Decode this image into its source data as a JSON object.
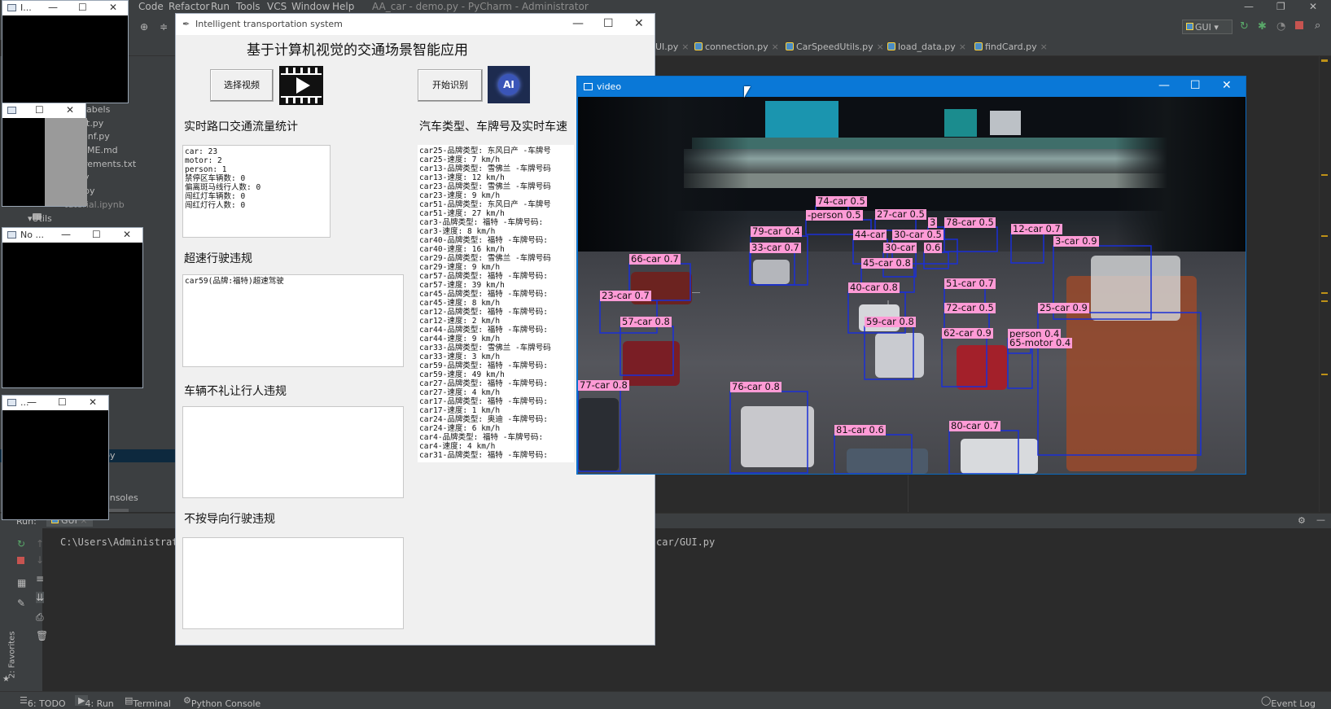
{
  "ide": {
    "menu": [
      "Code",
      "Refactor",
      "Run",
      "Tools",
      "VCS",
      "Window",
      "Help"
    ],
    "title": "AA_car - demo.py - PyCharm - Administrator",
    "run_config": "GUI",
    "tabs": [
      "UI.py",
      "connection.py",
      "CarSpeedUtils.py",
      "load_data.py",
      "findCard.py"
    ],
    "project_items": [
      "labels",
      "t.py",
      "onf.py",
      "ME.md",
      "rements.txt",
      "y",
      "py",
      "tutorial.ipynb",
      "Utils",
      "py",
      "onsoles"
    ],
    "run_label": "Run:",
    "run_tab": "GUI",
    "console_path_left": "C:\\Users\\Administrato",
    "console_path_right": "car/GUI.py",
    "status_items": [
      "6: TODO",
      "4: Run",
      "Terminal",
      "Python Console"
    ],
    "event_log": "Event Log",
    "favorites": "2: Favorites"
  },
  "small_windows": [
    {
      "title": "I..."
    },
    {
      "title": ""
    },
    {
      "title": "No ..."
    },
    {
      "title": "..."
    }
  ],
  "gui": {
    "title": "Intelligent transportation system",
    "heading": "基于计算机视觉的交通场景智能应用",
    "btn_select_video": "选择视频",
    "btn_start": "开始识别",
    "ai_badge": "AI",
    "section_flow": "实时路口交通流量统计",
    "section_types": "汽车类型、车牌号及实时车速",
    "section_speeding": "超速行驶违规",
    "section_pedestrian": "车辆不礼让行人违规",
    "section_direction": "不按导向行驶违规",
    "flow_lines": [
      "car: 23",
      "motor: 2",
      "person: 1",
      "禁停区车辆数: 0",
      "偏离斑马线行人数: 0",
      "闯红灯车辆数: 0",
      "闯红灯行人数: 0"
    ],
    "speeding_lines": [
      "car59(品牌:福特)超速驾驶"
    ],
    "type_lines": [
      "car25-品牌类型: 东风日产 -车牌号",
      "car25-速度: 7 km/h",
      "car13-品牌类型: 雪佛兰 -车牌号码",
      "car13-速度: 12 km/h",
      "car23-品牌类型: 雪佛兰 -车牌号码",
      "car23-速度: 9 km/h",
      "car51-品牌类型: 东风日产 -车牌号",
      "car51-速度: 27 km/h",
      "car3-品牌类型: 福特 -车牌号码:",
      "car3-速度: 8 km/h",
      "car40-品牌类型: 福特 -车牌号码:",
      "car40-速度: 16 km/h",
      "car29-品牌类型: 雪佛兰 -车牌号码",
      "car29-速度: 9 km/h",
      "car57-品牌类型: 福特 -车牌号码:",
      "car57-速度: 39 km/h",
      "car45-品牌类型: 福特 -车牌号码:",
      "car45-速度: 8 km/h",
      "car12-品牌类型: 福特 -车牌号码:",
      "car12-速度: 2 km/h",
      "car44-品牌类型: 福特 -车牌号码:",
      "car44-速度: 9 km/h",
      "car33-品牌类型: 雪佛兰 -车牌号码",
      "car33-速度: 3 km/h",
      "car59-品牌类型: 福特 -车牌号码:",
      "car59-速度: 49 km/h",
      "car27-品牌类型: 福特 -车牌号码:",
      "car27-速度: 4 km/h",
      "car17-品牌类型: 福特 -车牌号码:",
      "car17-速度: 1 km/h",
      "car24-品牌类型: 奥迪 -车牌号码:",
      "car24-速度: 6 km/h",
      "car4-品牌类型: 福特 -车牌号码:",
      "car4-速度: 4 km/h",
      "car31-品牌类型: 福特 -车牌号码:"
    ]
  },
  "video": {
    "title": "video",
    "detections": [
      "74-car 0.5",
      "-person 0.5",
      "27-car 0.5",
      "3",
      "78-car 0.5",
      "12-car 0.7",
      "79-car 0.4",
      "44-car",
      "30-car 0.5",
      "3-car 0.9",
      "33-car 0.7",
      "30-car",
      "0.6",
      "66-car 0.7",
      "45-car 0.8",
      "51-car 0.7",
      "40-car 0.8",
      "23-car 0.7",
      "72-car 0.5",
      "25-car 0.9",
      "57-car 0.8",
      "59-car 0.8",
      "62-car 0.9",
      "person 0.4",
      "65-motor 0.4",
      "77-car 0.8",
      "76-car 0.8",
      "81-car 0.6",
      "80-car 0.7"
    ]
  },
  "colors": {
    "label_bg": "#ff9bd6",
    "box": "#1a2fd6",
    "titlebar_active": "#0a78d7"
  }
}
